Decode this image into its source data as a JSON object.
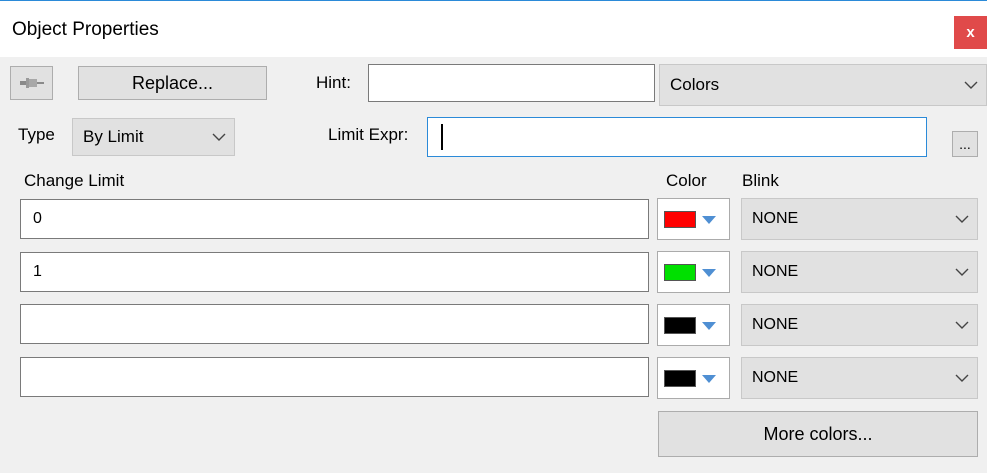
{
  "window": {
    "title": "Object Properties",
    "close_label": "x"
  },
  "toolbar": {
    "replace_label": "Replace...",
    "hint_label": "Hint:",
    "hint_value": "",
    "colors_select": "Colors"
  },
  "type_row": {
    "type_label": "Type",
    "type_value": "By Limit",
    "limit_expr_label": "Limit Expr:",
    "limit_expr_value": "",
    "browse_label": "..."
  },
  "table": {
    "headers": {
      "change_limit": "Change Limit",
      "color": "Color",
      "blink": "Blink"
    },
    "rows": [
      {
        "limit": "0",
        "color": "#ff0000",
        "blink": "NONE"
      },
      {
        "limit": "1",
        "color": "#00e000",
        "blink": "NONE"
      },
      {
        "limit": "",
        "color": "#000000",
        "blink": "NONE"
      },
      {
        "limit": "",
        "color": "#000000",
        "blink": "NONE"
      }
    ]
  },
  "footer": {
    "more_colors_label": "More colors..."
  },
  "icons": {
    "pin": "pin-icon",
    "close": "close-icon",
    "dropdown": "chevron-down-icon"
  },
  "theme": {
    "close_bg": "#e04a4a",
    "focus_border": "#2b8ad8",
    "dropdown_arrow": "#4f8fd3"
  }
}
